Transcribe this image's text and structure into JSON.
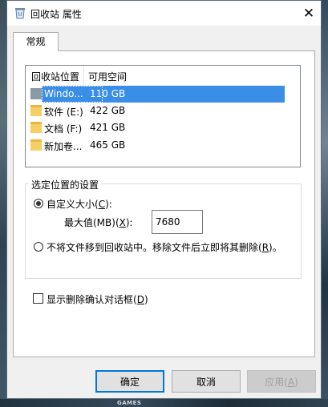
{
  "window": {
    "title": "回收站 属性",
    "close_glyph": "✕"
  },
  "tabs": [
    {
      "label": "常规"
    }
  ],
  "listview": {
    "columns": [
      "回收站位置",
      "可用空间"
    ],
    "rows": [
      {
        "name": "Windo...",
        "space": "110 GB",
        "icon": "drive-icon",
        "selected": true
      },
      {
        "name": "软件 (E:)",
        "space": "422 GB",
        "icon": "folder-icon",
        "selected": false
      },
      {
        "name": "文档 (F:)",
        "space": "421 GB",
        "icon": "folder-icon",
        "selected": false
      },
      {
        "name": "新加卷...",
        "space": "465 GB",
        "icon": "folder-icon",
        "selected": false
      }
    ]
  },
  "settings_group": {
    "title": "选定位置的设置",
    "custom_size": {
      "text": "自定义大小(",
      "key": "C",
      "suffix": "):",
      "checked": true
    },
    "max_value": {
      "text": "最大值(MB)(",
      "key": "X",
      "suffix": "):",
      "value": "7680"
    },
    "no_move": {
      "text": "不将文件移到回收站中。移除文件后立即将其删除(",
      "key": "R",
      "suffix": ")。",
      "checked": false
    }
  },
  "confirm_checkbox": {
    "text": "显示删除确认对话框(",
    "key": "D",
    "suffix": ")",
    "checked": false
  },
  "buttons": {
    "ok": "确定",
    "cancel": "取消",
    "apply": {
      "text": "应用(",
      "key": "A",
      "suffix": ")"
    }
  },
  "background": {
    "taskbar_text": "GAMES"
  },
  "colors": {
    "selection": "#3a8ee6",
    "default_button_border": "#0078d7",
    "dialog_bg": "#f0f0f0"
  }
}
